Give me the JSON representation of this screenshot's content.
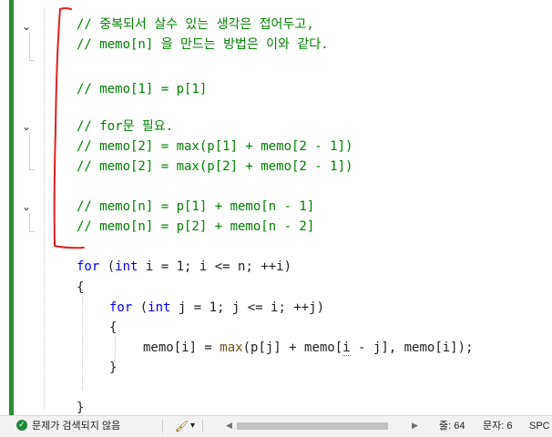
{
  "editor": {
    "lines": [
      {
        "kind": "comment",
        "indent": 0,
        "text": "// 중복되서 살수 있는 생각은 접어두고,"
      },
      {
        "kind": "comment",
        "indent": 0,
        "text": "// memo[n] 을 만드는 방법은 이와 같다."
      },
      {
        "kind": "comment",
        "indent": 0,
        "text": "// memo[1] = p[1]"
      },
      {
        "kind": "comment",
        "indent": 0,
        "text": "// for문 필요."
      },
      {
        "kind": "comment",
        "indent": 0,
        "text": "// memo[2] = max(p[1] + memo[2 - 1])"
      },
      {
        "kind": "comment",
        "indent": 0,
        "text": "// memo[2] = max(p[2] + memo[2 - 1])"
      },
      {
        "kind": "comment",
        "indent": 0,
        "text": "// memo[n] = p[1] + memo[n - 1]"
      },
      {
        "kind": "comment",
        "indent": 0,
        "text": "// memo[n] = p[2] + memo[n - 2]"
      }
    ],
    "code": {
      "outer_for_kw": "for",
      "outer_paren_open": " (",
      "outer_int_kw": "int",
      "outer_rest": " i = 1; i <= n; ++i)",
      "brace_open_1": "{",
      "inner_for_kw": "for",
      "inner_paren_open": " (",
      "inner_int_kw": "int",
      "inner_rest": " j = 1; j <= i; ++j)",
      "brace_open_2": "{",
      "body_a": "memo[i] = ",
      "body_fn": "max",
      "body_b": "(p[j] + memo[",
      "body_squiggle": "i",
      "body_c": " - j], memo[i]);",
      "brace_close_2": "}",
      "brace_close_1": "}"
    },
    "fold_chevron": "⌄"
  },
  "status_bar": {
    "issues_text": "문제가 검색되지 않음",
    "issues_icon": "check-circle",
    "brush_icon": "🖌",
    "dropdown_arrow": "▾",
    "line_label": "줄: 64",
    "col_label": "문자: 6",
    "mode": "SPC",
    "scroll_left": "◀",
    "scroll_right": "▶"
  },
  "colors": {
    "comment": "#008000",
    "keyword": "#0000ff",
    "function": "#74531f",
    "annotation_bracket": "#e02020",
    "change_bar": "#2e8b2e"
  }
}
